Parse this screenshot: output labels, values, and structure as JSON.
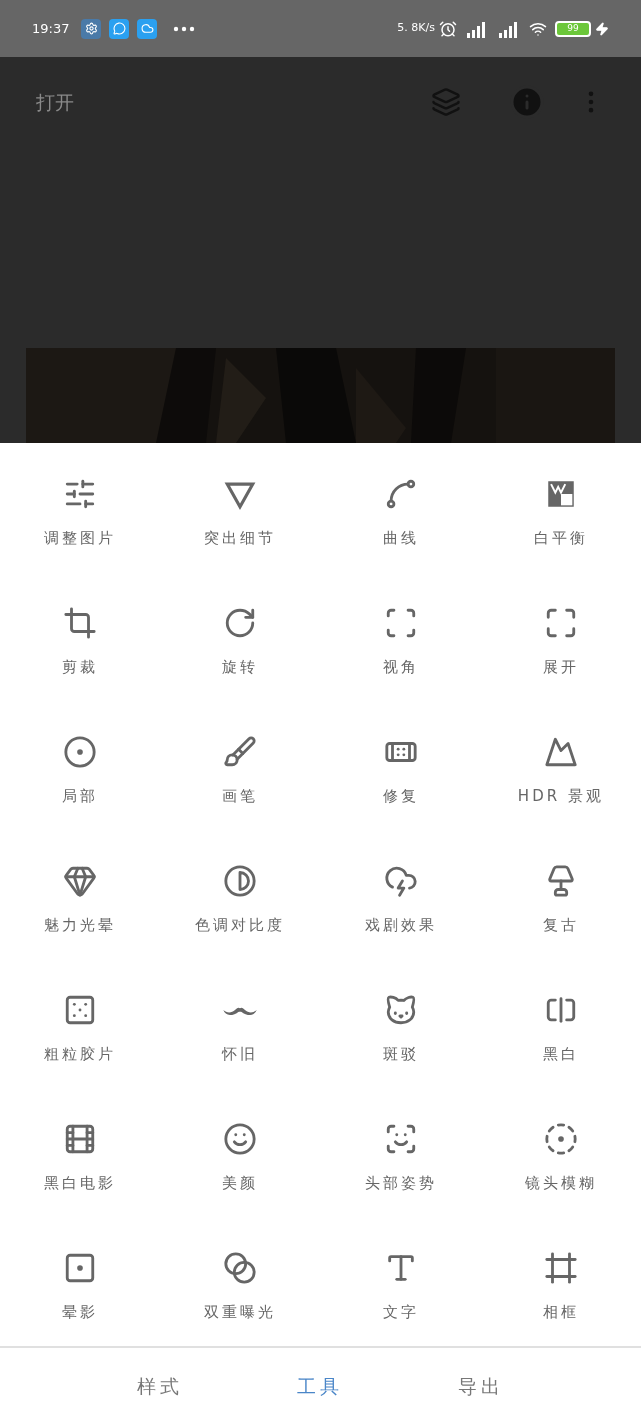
{
  "status_bar": {
    "time": "19:37",
    "speed": "5. 8K/s",
    "battery": "99"
  },
  "top_bar": {
    "title": "打开"
  },
  "tools": [
    {
      "label": "调整图片"
    },
    {
      "label": "突出细节"
    },
    {
      "label": "曲线"
    },
    {
      "label": "白平衡"
    },
    {
      "label": "剪裁"
    },
    {
      "label": "旋转"
    },
    {
      "label": "视角"
    },
    {
      "label": "展开"
    },
    {
      "label": "局部"
    },
    {
      "label": "画笔"
    },
    {
      "label": "修复"
    },
    {
      "label": "HDR 景观"
    },
    {
      "label": "魅力光晕"
    },
    {
      "label": "色调对比度"
    },
    {
      "label": "戏剧效果"
    },
    {
      "label": "复古"
    },
    {
      "label": "粗粒胶片"
    },
    {
      "label": "怀旧"
    },
    {
      "label": "斑驳"
    },
    {
      "label": "黑白"
    },
    {
      "label": "黑白电影"
    },
    {
      "label": "美颜"
    },
    {
      "label": "头部姿势"
    },
    {
      "label": "镜头模糊"
    },
    {
      "label": "晕影"
    },
    {
      "label": "双重曝光"
    },
    {
      "label": "文字"
    },
    {
      "label": "相框"
    }
  ],
  "bottom_tabs": [
    {
      "label": "样式",
      "selected": false
    },
    {
      "label": "工具",
      "selected": true
    },
    {
      "label": "导出",
      "selected": false
    }
  ]
}
